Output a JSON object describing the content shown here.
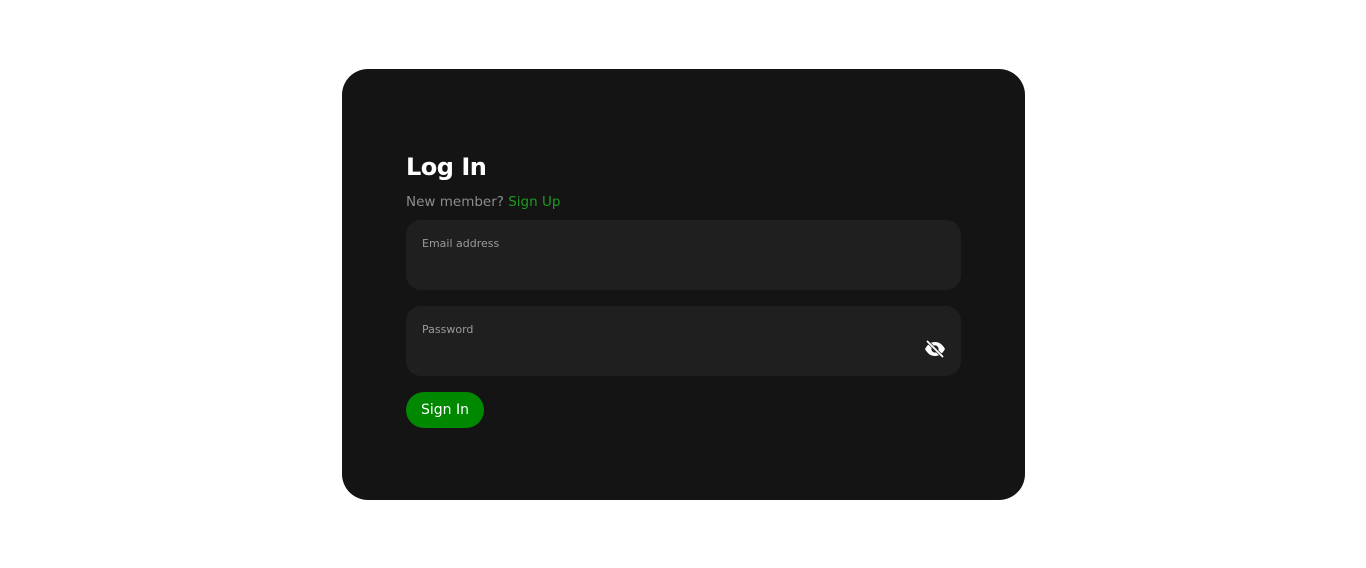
{
  "login": {
    "title": "Log In",
    "new_member_text": "New member?",
    "signup_link": "Sign Up",
    "email": {
      "label": "Email address",
      "value": ""
    },
    "password": {
      "label": "Password",
      "value": "",
      "toggle_icon": "eye-slash-icon"
    },
    "signin_label": "Sign In"
  },
  "colors": {
    "card_background": "#141414",
    "field_background": "#1f1f1f",
    "accent_green": "#008800",
    "link_green": "#1f9a1f",
    "muted_text": "#8c8c8c",
    "page_background": "#ffffff"
  }
}
